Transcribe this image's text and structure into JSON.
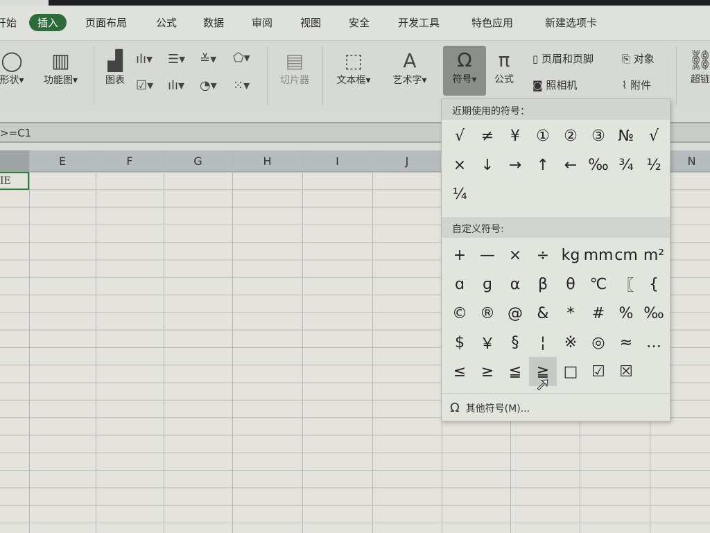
{
  "menu": {
    "tabs": [
      "开始",
      "插入",
      "页面布局",
      "公式",
      "数据",
      "审阅",
      "视图",
      "安全",
      "开发工具",
      "特色应用",
      "新建选项卡"
    ],
    "active": "插入"
  },
  "ribbon": {
    "shape": "形状",
    "funcmap": "功能图",
    "chart": "图表",
    "slicer": "切片器",
    "textbox": "文本框",
    "wordart": "艺术字",
    "symbol": "符号",
    "equation": "公式",
    "header_footer": "页眉和页脚",
    "object": "对象",
    "camera": "照相机",
    "attachment": "附件",
    "hyperlink": "超链"
  },
  "formula_bar": {
    "text": ">=C1"
  },
  "columns": [
    "E",
    "F",
    "G",
    "H",
    "I",
    "J",
    "N"
  ],
  "active_cell": {
    "text": "IE"
  },
  "symbol_menu": {
    "recent_label": "近期使用的符号：",
    "recent": [
      "√",
      "≠",
      "¥",
      "①",
      "②",
      "③",
      "№",
      "√",
      "×",
      "↓",
      "→",
      "↑",
      "←",
      "‰",
      "¾",
      "½",
      "¼"
    ],
    "custom_label": "自定义符号:",
    "custom": [
      "+",
      "—",
      "×",
      "÷",
      "kg",
      "mm",
      "cm",
      "m²",
      "ɑ",
      "ɡ",
      "α",
      "β",
      "θ",
      "℃",
      "〖",
      "{",
      "©",
      "®",
      "@",
      "&",
      "*",
      "#",
      "%",
      "‰",
      "$",
      "￥",
      "§",
      "¦",
      "※",
      "◎",
      "≈",
      "…",
      "≤",
      "≥",
      "≦",
      "≧",
      "□",
      "☑",
      "☒"
    ],
    "hovered": "≧",
    "more_label": "其他符号(M)...",
    "more_icon": "omega-icon"
  }
}
